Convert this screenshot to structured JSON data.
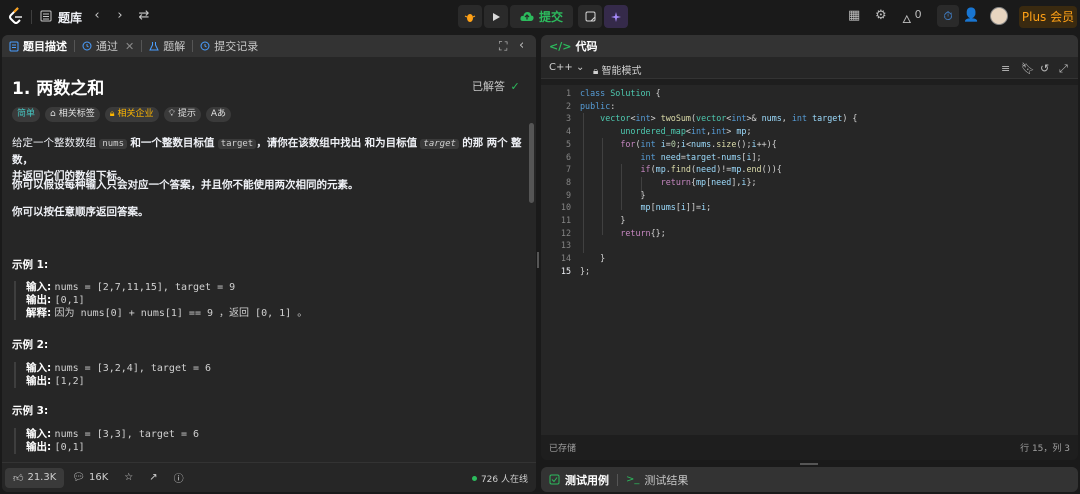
{
  "topnav": {
    "title": "题库",
    "submit_label": "提交",
    "plus_label": "Plus 会员",
    "streak_count": "0"
  },
  "left_tabs": [
    {
      "label": "题目描述",
      "icon": "document-icon"
    },
    {
      "label": "通过",
      "icon": "history-icon"
    },
    {
      "label": "题解",
      "icon": "flask-icon"
    },
    {
      "label": "提交记录",
      "icon": "history-icon"
    }
  ],
  "problem": {
    "title": "1. 两数之和",
    "solved_label": "已解答",
    "tags": [
      {
        "label": "简单",
        "kind": "easy"
      },
      {
        "label": "相关标签",
        "kind": "topics"
      },
      {
        "label": "相关企业",
        "kind": "company"
      },
      {
        "label": "提示",
        "kind": "hint"
      },
      {
        "label": "Aあ",
        "kind": "translate"
      }
    ],
    "desc1_a": "给定一个整数数组",
    "desc1_code1": "nums",
    "desc1_b": "和一个整数目标值",
    "desc1_code2": "target",
    "desc1_c": "，请你在该数组中找出",
    "desc1_bold1": "和为目标值",
    "desc1_code3": "target",
    "desc1_d": "的那",
    "desc1_bold2": "两个",
    "desc1_e": "整数，",
    "desc1_line2": "并返回它们的数组下标。",
    "desc2": "你可以假设每种输入只会对应一个答案，并且你不能使用两次相同的元素。",
    "desc3": "你可以按任意顺序返回答案。",
    "examples": [
      {
        "title": "示例 1:",
        "input_label": "输入:",
        "input": "nums = [2,7,11,15], target = 9",
        "output_label": "输出:",
        "output": "[0,1]",
        "explain_label": "解释:",
        "explain": "因为 nums[0] + nums[1] == 9 ，返回 [0, 1] 。"
      },
      {
        "title": "示例 2:",
        "input_label": "输入:",
        "input": "nums = [3,2,4], target = 6",
        "output_label": "输出:",
        "output": "[1,2]"
      },
      {
        "title": "示例 3:",
        "input_label": "输入:",
        "input": "nums = [3,3], target = 6",
        "output_label": "输出:",
        "output": "[0,1]"
      }
    ]
  },
  "bottom": {
    "likes": "21.3K",
    "comments": "16K",
    "online": "726 人在线"
  },
  "code_panel": {
    "title": "代码",
    "language": "C++",
    "mode": "智能模式",
    "saved": "已存储",
    "cursor": "行 15，列 3",
    "line_numbers": [
      "1",
      "2",
      "3",
      "4",
      "5",
      "6",
      "7",
      "8",
      "9",
      "10",
      "11",
      "12",
      "13",
      "14",
      "15"
    ]
  },
  "test_panel": {
    "tab1": "测试用例",
    "tab2": "测试结果"
  },
  "colors": {
    "accent": "#ffa116",
    "submit_green": "#2cbb5d",
    "easy": "#46c6c2"
  }
}
